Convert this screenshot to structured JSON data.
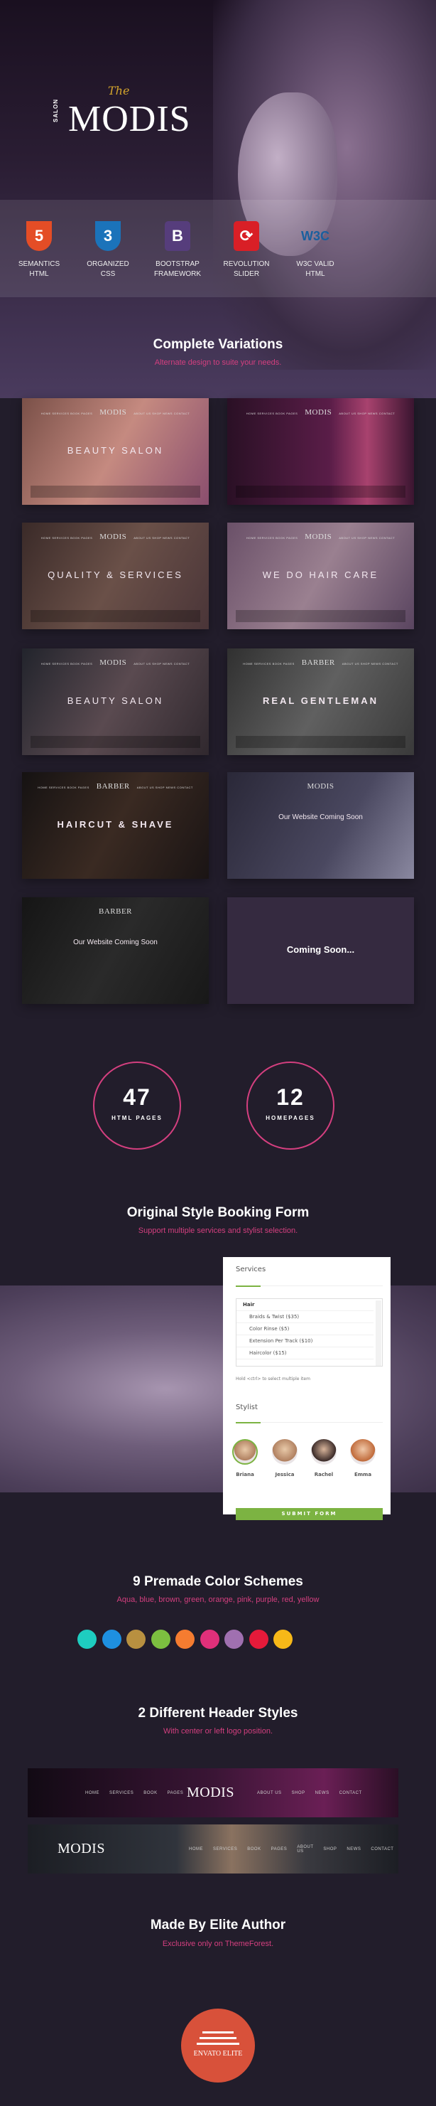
{
  "brand": {
    "the": "The",
    "salon": "SALON",
    "name": "MODIS"
  },
  "features": [
    {
      "icon": "html5-icon",
      "badge": "5",
      "line1": "SEMANTICS",
      "line2": "HTML",
      "color": "#e44d26"
    },
    {
      "icon": "css3-icon",
      "badge": "3",
      "line1": "ORGANIZED",
      "line2": "CSS",
      "color": "#1b73ba"
    },
    {
      "icon": "bootstrap-icon",
      "badge": "B",
      "line1": "BOOTSTRAP",
      "line2": "FRAMEWORK",
      "color": "#563d7c"
    },
    {
      "icon": "revolution-slider-icon",
      "badge": "⟳",
      "line1": "REVOLUTION",
      "line2": "SLIDER",
      "color": "#d91f26"
    },
    {
      "icon": "w3c-icon",
      "badge": "W3C",
      "line1": "W3C VALID",
      "line2": "HTML",
      "color": "#1a5f9e"
    }
  ],
  "variations": {
    "title": "Complete Variations",
    "subtitle": "Alternate design to suite your needs.",
    "nav": "HOME SERVICES BOOK PAGES",
    "nav2": "ABOUT US SHOP NEWS CONTACT",
    "thumbs": [
      {
        "headline": "BEAUTY SALON",
        "logo": "MODIS"
      },
      {
        "headline": "",
        "logo": "MODIS"
      },
      {
        "headline": "QUALITY & SERVICES",
        "logo": "MODIS"
      },
      {
        "headline": "WE DO HAIR CARE",
        "logo": "MODIS"
      },
      {
        "headline": "BEAUTY SALON",
        "logo": "MODIS"
      },
      {
        "headline": "REAL GENTLEMAN",
        "logo": "BARBER"
      },
      {
        "headline": "HAIRCUT & SHAVE",
        "logo": "BARBER"
      },
      {
        "headline": "Our Website Coming Soon",
        "logo": "MODIS"
      },
      {
        "headline": "Our Website Coming Soon",
        "logo": "BARBER"
      },
      {
        "headline": "Coming Soon...",
        "logo": ""
      }
    ]
  },
  "stats": [
    {
      "value": "47",
      "label": "HTML PAGES"
    },
    {
      "value": "12",
      "label": "HOMEPAGES"
    }
  ],
  "booking": {
    "title": "Original Style Booking Form",
    "subtitle": "Support multiple services and stylist selection.",
    "services_label": "Services",
    "group": "Hair",
    "services": [
      "Braids & Twist ($35)",
      "Color Rinse ($5)",
      "Extension Per Track ($10)",
      "Haircolor ($15)"
    ],
    "hint": "Hold <ctrl> to select multiple item",
    "stylist_label": "Stylist",
    "stylists": [
      "Briana",
      "Jessica",
      "Rachel",
      "Emma"
    ],
    "selected_stylist": "Briana",
    "submit": "SUBMIT FORM"
  },
  "colors": {
    "title": "9 Premade Color Schemes",
    "subtitle": "Aqua, blue, brown, green, orange, pink, purple, red, yellow",
    "swatches": [
      "#1ecdc0",
      "#1e90e0",
      "#b89040",
      "#7cbf40",
      "#f57c30",
      "#e0307a",
      "#a070b0",
      "#e51a3a",
      "#f7b818"
    ]
  },
  "headers": {
    "title": "2 Different Header Styles",
    "subtitle": "With center or left logo position.",
    "left_menu": [
      "HOME",
      "SERVICES",
      "BOOK",
      "PAGES"
    ],
    "right_menu": [
      "ABOUT US",
      "SHOP",
      "NEWS",
      "CONTACT"
    ],
    "all_menu": [
      "HOME",
      "SERVICES",
      "BOOK",
      "PAGES",
      "ABOUT US",
      "SHOP",
      "NEWS",
      "CONTACT"
    ]
  },
  "author": {
    "title": "Made By Elite Author",
    "subtitle": "Exclusive only on ThemeForest.",
    "badge": "ENVATO ELITE"
  }
}
